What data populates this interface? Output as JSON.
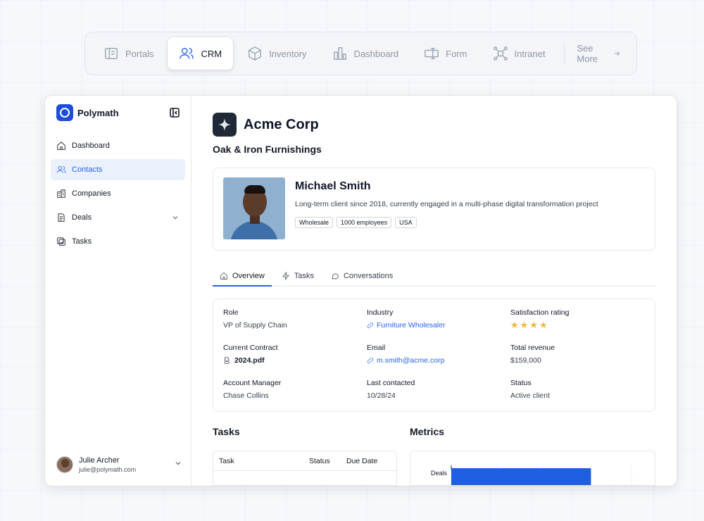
{
  "topnav": {
    "items": [
      {
        "label": "Portals",
        "icon": "portals-icon"
      },
      {
        "label": "CRM",
        "icon": "users-icon",
        "active": true
      },
      {
        "label": "Inventory",
        "icon": "box-icon"
      },
      {
        "label": "Dashboard",
        "icon": "bar-chart-icon"
      },
      {
        "label": "Form",
        "icon": "form-icon"
      },
      {
        "label": "Intranet",
        "icon": "network-icon"
      }
    ],
    "see_more": "See More"
  },
  "sidebar": {
    "brand": "Polymath",
    "items": [
      {
        "label": "Dashboard",
        "icon": "home-icon"
      },
      {
        "label": "Contacts",
        "icon": "users-icon",
        "active": true
      },
      {
        "label": "Companies",
        "icon": "building-icon"
      },
      {
        "label": "Deals",
        "icon": "document-icon"
      },
      {
        "label": "Tasks",
        "icon": "tasks-icon"
      }
    ],
    "user": {
      "name": "Julie Archer",
      "email": "julie@polymath.com"
    }
  },
  "company": {
    "name": "Acme Corp",
    "subtitle": "Oak & Iron Furnishings"
  },
  "contact": {
    "name": "Michael Smith",
    "description": "Long-term client since 2018, currently engaged in a multi-phase digital transformation project",
    "tags": [
      "Wholesale",
      "1000 employees",
      "USA"
    ]
  },
  "tabs": [
    {
      "label": "Overview",
      "icon": "home-icon",
      "active": true
    },
    {
      "label": "Tasks",
      "icon": "bolt-icon"
    },
    {
      "label": "Conversations",
      "icon": "chat-icon"
    }
  ],
  "details": {
    "role_label": "Role",
    "role": "VP of Supply Chain",
    "industry_label": "Industry",
    "industry": "Furniture Wholesaler",
    "satisfaction_label": "Satisfaction rating",
    "satisfaction_stars": 4,
    "contract_label": "Current Contract",
    "contract": "2024.pdf",
    "email_label": "Email",
    "email": "m.smith@acme.corp",
    "revenue_label": "Total revenue",
    "revenue": "$159,000",
    "manager_label": "Account Manager",
    "manager": "Chase Collins",
    "last_contacted_label": "Last contacted",
    "last_contacted": "10/28/24",
    "status_label": "Status",
    "status": "Active client"
  },
  "tasks_section": {
    "title": "Tasks",
    "columns": [
      "Task",
      "Status",
      "Due Date"
    ]
  },
  "metrics_section": {
    "title": "Metrics",
    "chart_data": {
      "type": "bar",
      "categories": [
        "Deals"
      ],
      "values": [
        1
      ]
    }
  },
  "colors": {
    "accent": "#2563eb",
    "star": "#f5b63b"
  }
}
